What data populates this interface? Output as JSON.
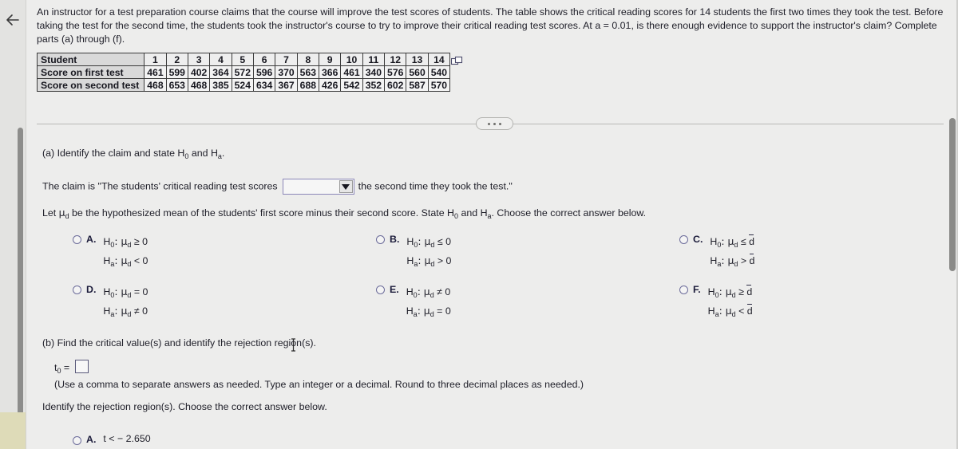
{
  "window": {
    "background_color": "#ededec",
    "back_icon": "back-arrow-icon"
  },
  "problem": {
    "statement": "An instructor for a test preparation course claims that the course will improve the test scores of students. The table shows the critical reading scores for 14 students the first two times they took the test. Before taking the test for the second time, the students took the instructor's course to try to improve their critical reading test scores. At a = 0.01, is there enough evidence to support the instructor's claim? Complete parts (a) through (f)."
  },
  "data_table": {
    "copy_icon": "copy-icon",
    "row_labels": [
      "Student",
      "Score on first test",
      "Score on second test"
    ],
    "students": [
      "1",
      "2",
      "3",
      "4",
      "5",
      "6",
      "7",
      "8",
      "9",
      "10",
      "11",
      "12",
      "13",
      "14"
    ],
    "first_test": [
      "461",
      "599",
      "402",
      "364",
      "572",
      "596",
      "370",
      "563",
      "366",
      "461",
      "340",
      "576",
      "560",
      "540"
    ],
    "second_test": [
      "468",
      "653",
      "468",
      "385",
      "524",
      "634",
      "367",
      "688",
      "426",
      "542",
      "352",
      "602",
      "587",
      "570"
    ]
  },
  "divider": {
    "ellipsis_label": "..."
  },
  "part_a": {
    "prompt_prefix": "(a) Identify the claim and state H",
    "prompt_sub1": "0",
    "prompt_mid": " and H",
    "prompt_sub2": "a",
    "prompt_suffix": ".",
    "claim_prefix": "The claim is \"The students' critical reading test scores",
    "claim_suffix": "the second time they took the test.\"",
    "dropdown_value": "",
    "dropdown_placeholder": "",
    "let_line": "Let μd be the hypothesized mean of the students' first score minus their second score. State H0 and Ha. Choose the correct answer below.",
    "let_part1": "Let ",
    "let_mu": "μ",
    "let_mu_sub": "d",
    "let_part2": " be the hypothesized mean of the students' first score minus their second score. State H",
    "let_sub0": "0",
    "let_part3": " and H",
    "let_suba": "a",
    "let_part4": ". Choose the correct answer below."
  },
  "choices": [
    {
      "letter": "A.",
      "null_left": "H",
      "null_sub": "0",
      "null_sep": ": μ",
      "null_sub2": "d",
      "null_rel": " ≥ 0",
      "alt_left": "H",
      "alt_sub": "a",
      "alt_sep": ": μ",
      "alt_sub2": "d",
      "alt_rel": " < 0",
      "selected": false
    },
    {
      "letter": "B.",
      "null_left": "H",
      "null_sub": "0",
      "null_sep": ": μ",
      "null_sub2": "d",
      "null_rel": " ≤ 0",
      "alt_left": "H",
      "alt_sub": "a",
      "alt_sep": ": μ",
      "alt_sub2": "d",
      "alt_rel": " > 0",
      "selected": false
    },
    {
      "letter": "C.",
      "null_left": "H",
      "null_sub": "0",
      "null_sep": ": μ",
      "null_sub2": "d",
      "null_rel": " ≤ ",
      "null_dbar": "d",
      "alt_left": "H",
      "alt_sub": "a",
      "alt_sep": ": μ",
      "alt_sub2": "d",
      "alt_rel": " > ",
      "alt_dbar": "d",
      "selected": false
    },
    {
      "letter": "D.",
      "null_left": "H",
      "null_sub": "0",
      "null_sep": ": μ",
      "null_sub2": "d",
      "null_rel": " = 0",
      "alt_left": "H",
      "alt_sub": "a",
      "alt_sep": ": μ",
      "alt_sub2": "d",
      "alt_rel": " ≠ 0",
      "selected": false
    },
    {
      "letter": "E.",
      "null_left": "H",
      "null_sub": "0",
      "null_sep": ": μ",
      "null_sub2": "d",
      "null_rel": " ≠ 0",
      "alt_left": "H",
      "alt_sub": "a",
      "alt_sep": ": μ",
      "alt_sub2": "d",
      "alt_rel": " = 0",
      "selected": false
    },
    {
      "letter": "F.",
      "null_left": "H",
      "null_sub": "0",
      "null_sep": ": μ",
      "null_sub2": "d",
      "null_rel": " ≥ ",
      "null_dbar": "d",
      "alt_left": "H",
      "alt_sub": "a",
      "alt_sep": ": μ",
      "alt_sub2": "d",
      "alt_rel": " < ",
      "alt_dbar": "d",
      "selected": false
    }
  ],
  "part_b": {
    "prompt": "(b) Find the critical value(s) and identify the rejection region(s).",
    "t0_label": "t",
    "t0_sub": "0",
    "t0_equals": " = ",
    "t0_value": "",
    "hint": "(Use a comma to separate answers as needed. Type an integer or a decimal. Round to three decimal places as needed.)",
    "identify_prompt": "Identify the rejection region(s). Choose the correct answer below.",
    "bottom_choice_letter": "A.",
    "bottom_choice_text": "t < − 2.650"
  }
}
